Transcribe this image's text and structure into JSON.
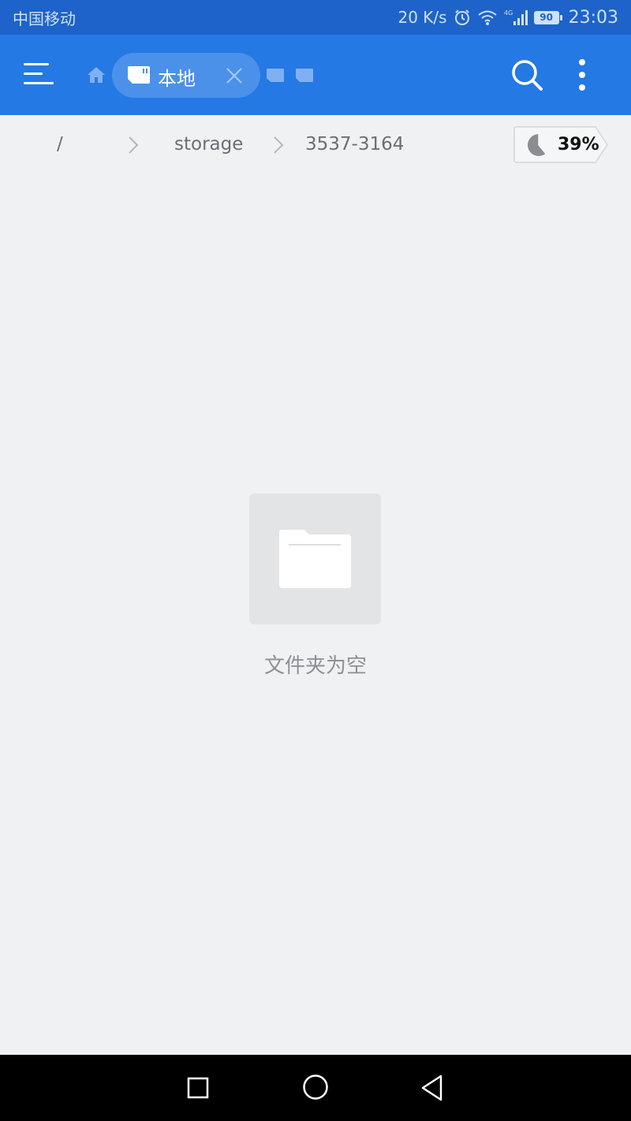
{
  "status_bar": {
    "carrier": "中国移动",
    "net_speed": "20 K/s",
    "network_type": "4G",
    "battery": "90",
    "time": "23:03"
  },
  "toolbar": {
    "tab_label": "本地"
  },
  "breadcrumb": {
    "items": [
      "/",
      "storage",
      "3537-3164"
    ],
    "usage": "39%",
    "usage_fraction": 0.39
  },
  "empty_state": {
    "message": "文件夹为空"
  },
  "colors": {
    "status_bar": "#1d63c9",
    "toolbar": "#2479e4",
    "active_tab": "#4b91ea",
    "background": "#f0f1f3"
  }
}
